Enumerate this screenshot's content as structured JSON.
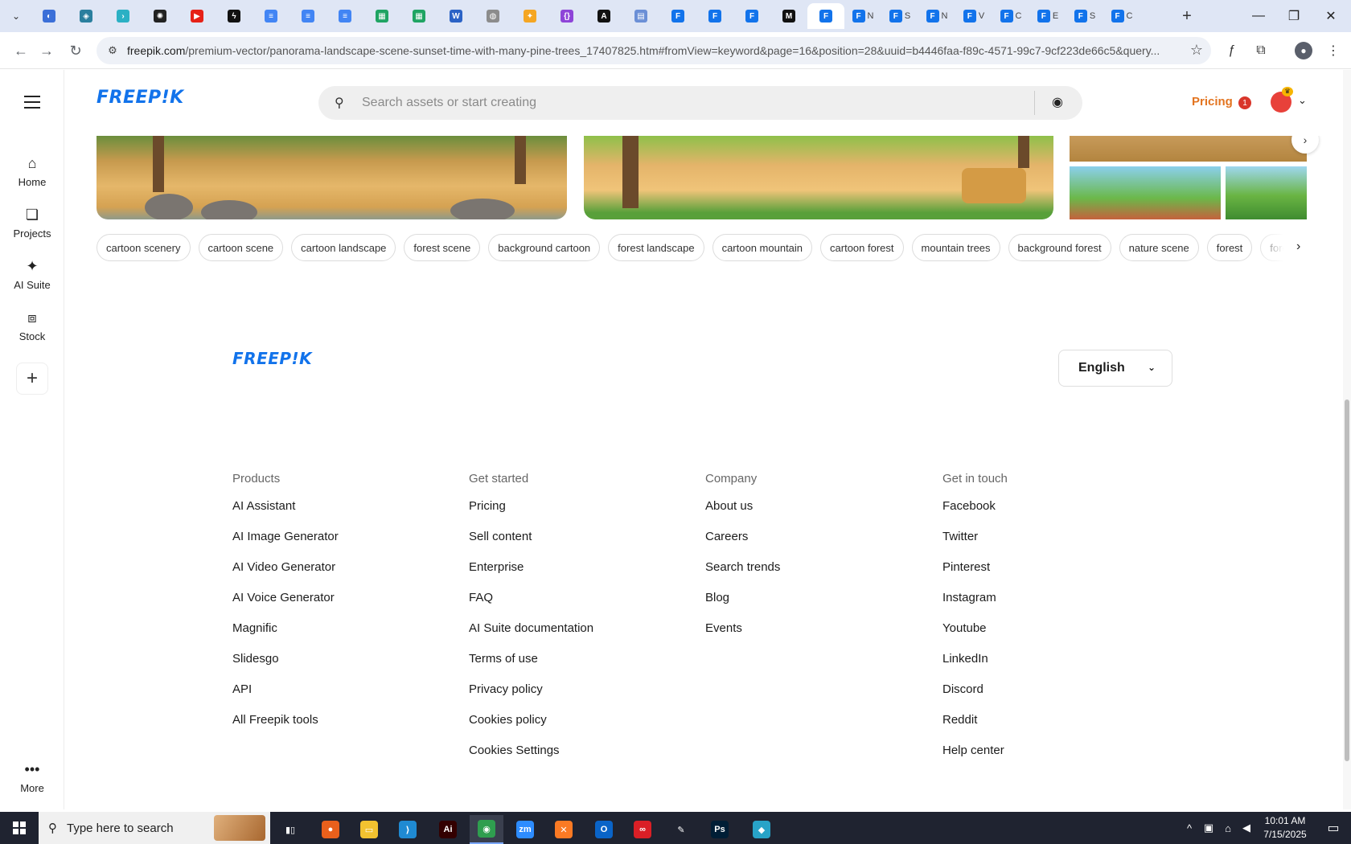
{
  "browser": {
    "tabs": [
      {
        "icon": "globe-tab-icon",
        "color": "#3b6fd8",
        "glyph": "◐",
        "title": ""
      },
      {
        "icon": "shield-tab-icon",
        "color": "#2a7f9e",
        "glyph": "◈",
        "title": ""
      },
      {
        "icon": "arrow-tab-icon",
        "color": "#2bb0c4",
        "glyph": "›",
        "title": ""
      },
      {
        "icon": "openai-tab-icon",
        "color": "#222222",
        "glyph": "✺",
        "title": ""
      },
      {
        "icon": "youtube-tab-icon",
        "color": "#e62117",
        "glyph": "▶",
        "title": ""
      },
      {
        "icon": "bolt-tab-icon",
        "color": "#111111",
        "glyph": "ϟ",
        "title": ""
      },
      {
        "icon": "docs-tab-icon",
        "color": "#4285f4",
        "glyph": "≡",
        "title": ""
      },
      {
        "icon": "docs-tab-icon",
        "color": "#4285f4",
        "glyph": "≡",
        "title": ""
      },
      {
        "icon": "docs-tab-icon",
        "color": "#4285f4",
        "glyph": "≡",
        "title": ""
      },
      {
        "icon": "sheets-tab-icon",
        "color": "#1fa463",
        "glyph": "▦",
        "title": ""
      },
      {
        "icon": "sheets-tab-icon",
        "color": "#1fa463",
        "glyph": "▦",
        "title": ""
      },
      {
        "icon": "word-tab-icon",
        "color": "#2b63c6",
        "glyph": "W",
        "title": ""
      },
      {
        "icon": "globe-tab-icon",
        "color": "#8c8c8c",
        "glyph": "◍",
        "title": ""
      },
      {
        "icon": "yellow-tab-icon",
        "color": "#f5a623",
        "glyph": "✦",
        "title": ""
      },
      {
        "icon": "braces-tab-icon",
        "color": "#8e44d8",
        "glyph": "{}",
        "title": ""
      },
      {
        "icon": "anthropic-tab-icon",
        "color": "#111111",
        "glyph": "A",
        "title": ""
      },
      {
        "icon": "grid-tab-icon",
        "color": "#6b8fd6",
        "glyph": "▤",
        "title": ""
      },
      {
        "icon": "freepik-tab-icon",
        "color": "#1273eb",
        "glyph": "F",
        "title": ""
      },
      {
        "icon": "freepik-tab-icon",
        "color": "#1273eb",
        "glyph": "F",
        "title": ""
      },
      {
        "icon": "freepik-tab-icon",
        "color": "#1273eb",
        "glyph": "F",
        "title": ""
      },
      {
        "icon": "medium-tab-icon",
        "color": "#111111",
        "glyph": "M",
        "title": ""
      },
      {
        "icon": "freepik-tab-icon",
        "color": "#1273eb",
        "glyph": "F",
        "title": "",
        "active": true
      },
      {
        "icon": "freepik-tab-icon",
        "color": "#1273eb",
        "glyph": "F",
        "title": "N"
      },
      {
        "icon": "freepik-tab-icon",
        "color": "#1273eb",
        "glyph": "F",
        "title": "S"
      },
      {
        "icon": "freepik-tab-icon",
        "color": "#1273eb",
        "glyph": "F",
        "title": "N"
      },
      {
        "icon": "freepik-tab-icon",
        "color": "#1273eb",
        "glyph": "F",
        "title": "V"
      },
      {
        "icon": "freepik-tab-icon",
        "color": "#1273eb",
        "glyph": "F",
        "title": "C"
      },
      {
        "icon": "freepik-tab-icon",
        "color": "#1273eb",
        "glyph": "F",
        "title": "E"
      },
      {
        "icon": "freepik-tab-icon",
        "color": "#1273eb",
        "glyph": "F",
        "title": "S"
      },
      {
        "icon": "freepik-tab-icon",
        "color": "#1273eb",
        "glyph": "F",
        "title": "C"
      }
    ],
    "url_host": "freepik.com",
    "url_path": "/premium-vector/panorama-landscape-scene-sunset-time-with-many-pine-trees_17407825.htm#fromView=keyword&page=16&position=28&uuid=b4446faa-f89c-4571-99c7-9cf223de66c5&query..."
  },
  "app": {
    "logo": "FREEP!K",
    "search_placeholder": "Search assets or start creating",
    "pricing": "Pricing",
    "notification_count": "1"
  },
  "sidebar": {
    "items": [
      {
        "label": "Home",
        "icon": "home-icon"
      },
      {
        "label": "Projects",
        "icon": "projects-icon"
      },
      {
        "label": "AI Suite",
        "icon": "sparkle-icon"
      },
      {
        "label": "Stock",
        "icon": "stock-icon"
      }
    ],
    "more": "More"
  },
  "tags": [
    "cartoon scenery",
    "cartoon scene",
    "cartoon landscape",
    "forest scene",
    "background cartoon",
    "forest landscape",
    "cartoon mountain",
    "cartoon forest",
    "mountain trees",
    "background forest",
    "nature scene",
    "forest",
    "forest trees"
  ],
  "footer": {
    "logo": "FREEP!K",
    "language": "English",
    "columns": [
      {
        "title": "Products",
        "links": [
          "AI Assistant",
          "AI Image Generator",
          "AI Video Generator",
          "AI Voice Generator",
          "Magnific",
          "Slidesgo",
          "API",
          "All Freepik tools"
        ]
      },
      {
        "title": "Get started",
        "links": [
          "Pricing",
          "Sell content",
          "Enterprise",
          "FAQ",
          "AI Suite documentation",
          "Terms of use",
          "Privacy policy",
          "Cookies policy",
          "Cookies Settings"
        ]
      },
      {
        "title": "Company",
        "links": [
          "About us",
          "Careers",
          "Search trends",
          "Blog",
          "Events"
        ]
      },
      {
        "title": "Get in touch",
        "links": [
          "Facebook",
          "Twitter",
          "Pinterest",
          "Instagram",
          "Youtube",
          "LinkedIn",
          "Discord",
          "Reddit",
          "Help center"
        ]
      }
    ]
  },
  "taskbar": {
    "search_placeholder": "Type here to search",
    "apps": [
      {
        "name": "task-view-icon",
        "color": "#1f2330",
        "glyph": "▮▯"
      },
      {
        "name": "firefox-icon",
        "color": "#e8601c",
        "glyph": "●"
      },
      {
        "name": "file-explorer-icon",
        "color": "#f2c230",
        "glyph": "▭"
      },
      {
        "name": "vscode-icon",
        "color": "#1f8ad2",
        "glyph": "⟩"
      },
      {
        "name": "illustrator-icon",
        "color": "#330000",
        "glyph": "Ai"
      },
      {
        "name": "chrome-icon",
        "color": "#2f9e4f",
        "glyph": "◉",
        "active": true
      },
      {
        "name": "zoom-icon",
        "color": "#2d8cff",
        "glyph": "zm"
      },
      {
        "name": "xampp-icon",
        "color": "#fb7a24",
        "glyph": "✕"
      },
      {
        "name": "outlook-icon",
        "color": "#0a64c8",
        "glyph": "O"
      },
      {
        "name": "creative-cloud-icon",
        "color": "#da1f26",
        "glyph": "∞"
      },
      {
        "name": "pen-tool-icon",
        "color": "#1f2330",
        "glyph": "✎"
      },
      {
        "name": "photoshop-icon",
        "color": "#001e36",
        "glyph": "Ps"
      },
      {
        "name": "app-diamond-icon",
        "color": "#28a3c7",
        "glyph": "◆"
      }
    ],
    "time": "10:01 AM",
    "date": "7/15/2025"
  }
}
